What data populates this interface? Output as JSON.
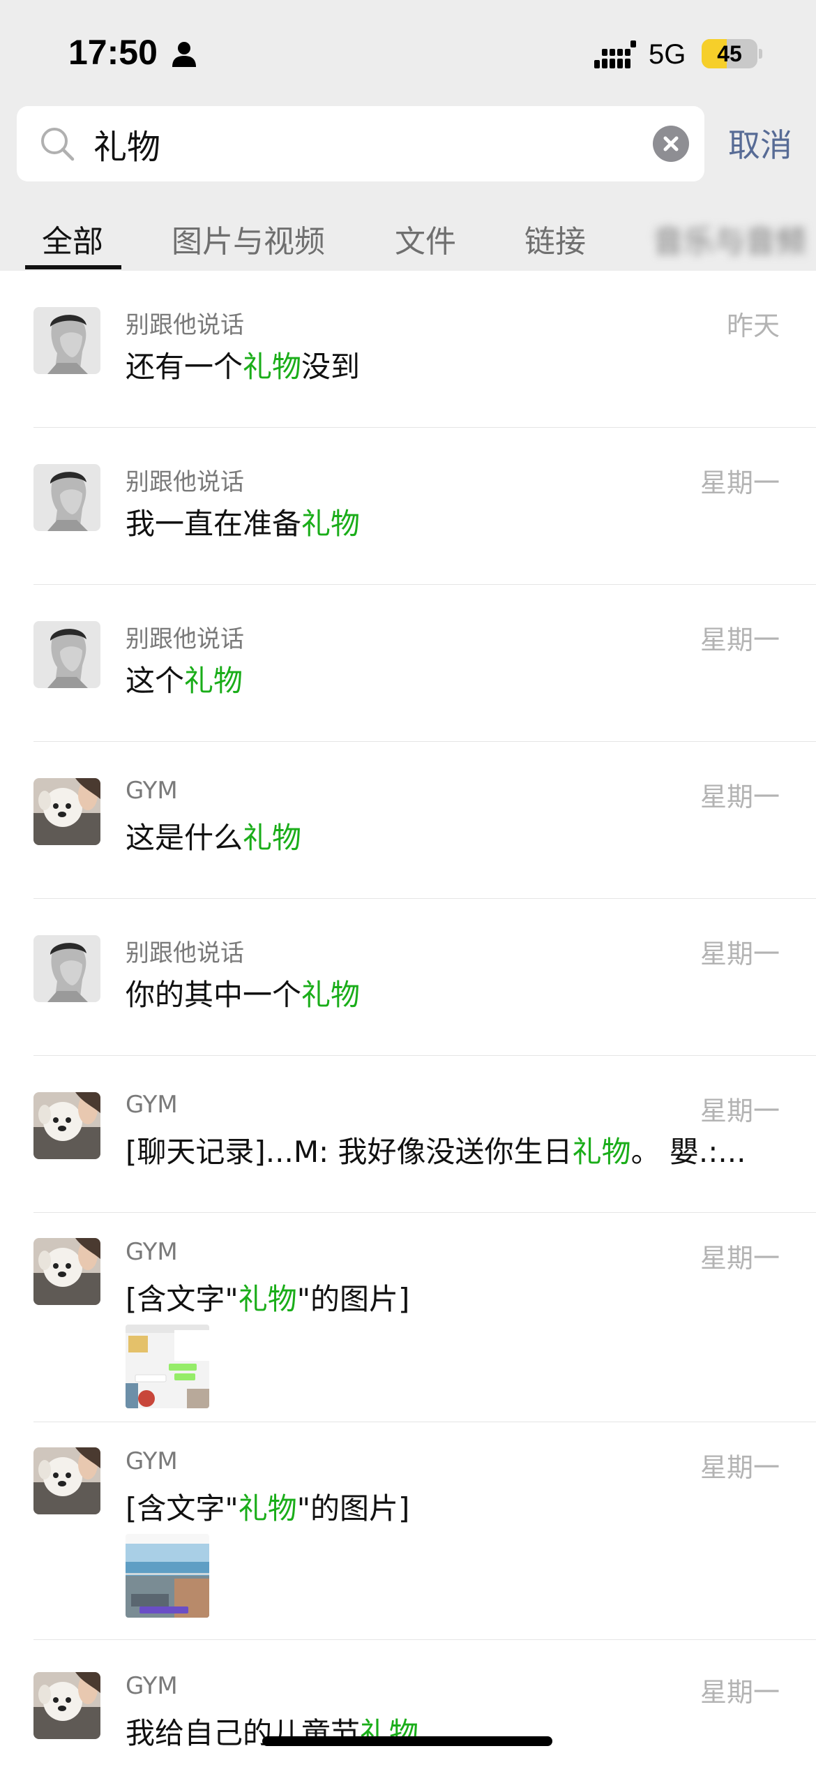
{
  "status_bar": {
    "time": "17:50",
    "network": "5G",
    "battery": "45",
    "battery_level": 0.45
  },
  "search": {
    "query": "礼物",
    "cancel_label": "取消"
  },
  "tabs": [
    {
      "label": "全部"
    },
    {
      "label": "图片与视频"
    },
    {
      "label": "文件"
    },
    {
      "label": "链接"
    },
    {
      "label": "音乐与音频"
    }
  ],
  "results": [
    {
      "sender": "别跟他说话",
      "time": "昨天",
      "pre": "还有一个",
      "hit": "礼物",
      "post": "没到",
      "avatar": "portrait-avatar"
    },
    {
      "sender": "别跟他说话",
      "time": "星期一",
      "pre": "我一直在准备",
      "hit": "礼物",
      "post": "",
      "avatar": "portrait-avatar"
    },
    {
      "sender": "别跟他说话",
      "time": "星期一",
      "pre": "这个",
      "hit": "礼物",
      "post": "",
      "avatar": "portrait-avatar"
    },
    {
      "sender": "GYM",
      "time": "星期一",
      "pre": "这是什么",
      "hit": "礼物",
      "post": "",
      "avatar": "dog-avatar"
    },
    {
      "sender": "别跟他说话",
      "time": "星期一",
      "pre": "你的其中一个",
      "hit": "礼物",
      "post": "",
      "avatar": "portrait-avatar"
    },
    {
      "sender": "GYM",
      "time": "星期一",
      "pre": "[聊天记录]...M: 我好像没送你生日",
      "hit": "礼物",
      "post": "。 嬰.:...",
      "avatar": "dog-avatar"
    },
    {
      "sender": "GYM",
      "time": "星期一",
      "pre": "[含文字\"",
      "hit": "礼物",
      "post": "\"的图片]",
      "avatar": "dog-avatar",
      "thumb": "chat-screenshot-thumbnail"
    },
    {
      "sender": "GYM",
      "time": "星期一",
      "pre": "[含文字\"",
      "hit": "礼物",
      "post": "\"的图片]",
      "avatar": "dog-avatar",
      "thumb": "balcony-photo-thumbnail"
    },
    {
      "sender": "GYM",
      "time": "星期一",
      "pre": "我给自己的儿童节",
      "hit": "礼物",
      "post": "",
      "avatar": "dog-avatar"
    }
  ],
  "colors": {
    "highlight": "#1aad19",
    "link": "#576b95",
    "background_top": "#ededed"
  }
}
